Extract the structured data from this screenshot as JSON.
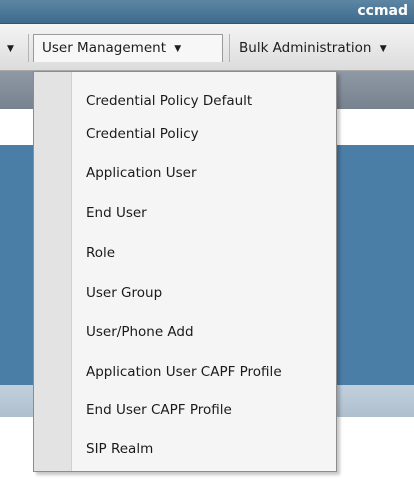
{
  "titlebar": {
    "host": "ccmad"
  },
  "menubar": {
    "prev_arrow": "▼",
    "user_management": "User Management",
    "user_management_arrow": "▼",
    "bulk_administration": "Bulk Administration",
    "bulk_administration_arrow": "▼"
  },
  "dropdown": {
    "items": [
      "Credential Policy Default",
      "Credential Policy",
      "Application User",
      "End User",
      "Role",
      "User Group",
      "User/Phone Add",
      "Application User CAPF Profile",
      "End User CAPF Profile",
      "SIP Realm"
    ]
  },
  "colors": {
    "titlebar": "#4a7698",
    "menubar": "#e8e8e8",
    "page_band_dark": "#4b7ea7",
    "page_band_grey": "#838d9a",
    "page_band_light": "#b8c8d6",
    "dropdown_bg": "#f5f5f5",
    "dropdown_gutter": "#e3e3e3"
  }
}
